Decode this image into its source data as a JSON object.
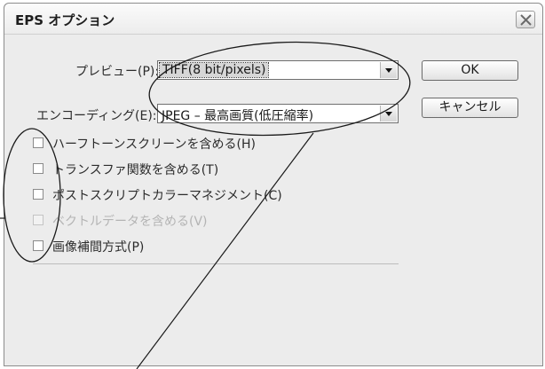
{
  "window": {
    "title": "EPS オプション"
  },
  "preview": {
    "label": "プレビュー(P):",
    "value": "TIFF(8 bit/pixels)"
  },
  "encoding": {
    "label": "エンコーディング(E):",
    "value": "JPEG – 最高画質(低圧縮率)"
  },
  "buttons": {
    "ok": "OK",
    "cancel": "キャンセル"
  },
  "options": [
    {
      "label": "ハーフトーンスクリーンを含める(H)",
      "checked": false,
      "enabled": true
    },
    {
      "label": "トランスファ関数を含める(T)",
      "checked": false,
      "enabled": true
    },
    {
      "label": "ポストスクリプトカラーマネジメント(C)",
      "checked": false,
      "enabled": true
    },
    {
      "label": "ベクトルデータを含める(V)",
      "checked": false,
      "enabled": false
    },
    {
      "label": "画像補間方式(P)",
      "checked": false,
      "enabled": true
    }
  ],
  "icons": {
    "close": "close-icon",
    "dropdown": "chevron-down-icon"
  }
}
